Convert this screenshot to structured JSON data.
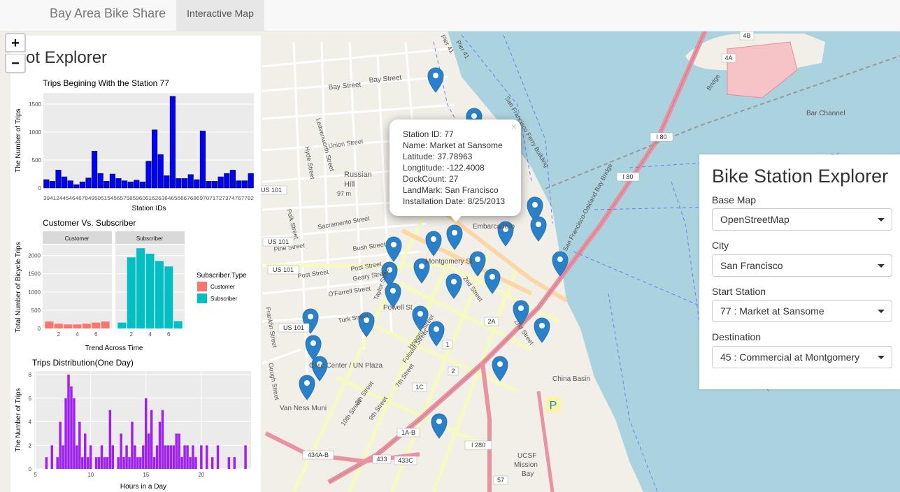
{
  "navbar": {
    "brand": "Bay Area Bike Share",
    "tab_active": "Interactive Map"
  },
  "map": {
    "zoom_in": "+",
    "zoom_out": "−",
    "labels": [
      {
        "text": "Bay Street"
      },
      {
        "text": "Bay Street"
      },
      {
        "text": "Leavenworth Street"
      },
      {
        "text": "Hyde Street"
      },
      {
        "text": "Union Street"
      },
      {
        "text": "Russian"
      },
      {
        "text": "Hill"
      },
      {
        "text": "97 m"
      },
      {
        "text": "Polk Street"
      },
      {
        "text": "Sacramento Street"
      },
      {
        "text": "Pine Street"
      },
      {
        "text": "Bush Street"
      },
      {
        "text": "Post Street"
      },
      {
        "text": "Geary Street"
      },
      {
        "text": "Post Street"
      },
      {
        "text": "O'Farrell Street"
      },
      {
        "text": "Taylor Street"
      },
      {
        "text": "Powell St"
      },
      {
        "text": "Turk Street"
      },
      {
        "text": "Civic Center / UN Plaza"
      },
      {
        "text": "Van Ness Muni"
      },
      {
        "text": "7th Street"
      },
      {
        "text": "8th Street"
      },
      {
        "text": "9th Street"
      },
      {
        "text": "10th Street"
      },
      {
        "text": "Folsom Street"
      },
      {
        "text": "Howard Street"
      },
      {
        "text": "2nd Street"
      },
      {
        "text": "2nd Street"
      },
      {
        "text": "Montgomery St"
      },
      {
        "text": "Embarcadero"
      },
      {
        "text": "China Basin"
      },
      {
        "text": "UCSF"
      },
      {
        "text": "Mission"
      },
      {
        "text": "Bay"
      },
      {
        "text": "Bar Channel"
      },
      {
        "text": "San Francisco-Oakland Bay Bridge"
      },
      {
        "text": "Bridge"
      },
      {
        "text": "Pier 41"
      },
      {
        "text": "San Francisco Ferry Building"
      },
      {
        "text": "Gough Street"
      },
      {
        "text": "Franklin Street"
      },
      {
        "text": "Pier 41"
      }
    ],
    "shields": [
      {
        "text": "US 101"
      },
      {
        "text": "US 101"
      },
      {
        "text": "US 101"
      },
      {
        "text": "US 101"
      },
      {
        "text": "I 80"
      },
      {
        "text": "I 80"
      },
      {
        "text": "I 280"
      },
      {
        "text": "1A-B"
      },
      {
        "text": "1C"
      },
      {
        "text": "2A"
      },
      {
        "text": "433"
      },
      {
        "text": "433C"
      },
      {
        "text": "434A-B"
      },
      {
        "text": "57"
      },
      {
        "text": "4A"
      },
      {
        "text": "4B"
      },
      {
        "text": "1"
      },
      {
        "text": "2"
      }
    ],
    "parking": "P"
  },
  "popup": {
    "close": "×",
    "lines": [
      "Station ID: 77",
      "Name: Market at Sansome",
      "Latitude: 37.78963",
      "Longtitude: -122.4008",
      "DockCount: 27",
      "LandMark: San Francisco",
      "Installation Date: 8/25/2013"
    ]
  },
  "left_panel": {
    "title": "ot Explorer",
    "bar": {
      "title": "Trips Begining With the Station 77",
      "ylabel": "The Number of Trips",
      "xlabel": "Station IDs",
      "xticks_text": "394124454646784950515456575859606162636465666768697071727374767782",
      "yticks": [
        "0",
        "500",
        "1000",
        "1500"
      ],
      "color": "#0000ff"
    },
    "facet": {
      "title": "Customer Vs. Subscriber",
      "ylabel": "Total Number of Bicycle Trips",
      "xlabel": "Trend Across Time",
      "strips": [
        "Customer",
        "Subscriber"
      ],
      "yticks": [
        "0",
        "500",
        "1000",
        "1500",
        "2000"
      ],
      "xticks": [
        "2",
        "4",
        "6"
      ],
      "legend_title": "Subscriber.Type",
      "legend": [
        {
          "label": "Customer",
          "color": "#f8766d"
        },
        {
          "label": "Subscriber",
          "color": "#00bfc4"
        }
      ]
    },
    "hist": {
      "title": "Trips Distribution(One Day)",
      "ylabel": "The Number of Trips",
      "xlabel": "Hours in a Day",
      "yticks": [
        "0",
        "2",
        "4",
        "6",
        "8"
      ],
      "xticks": [
        "5",
        "10",
        "15",
        "20"
      ],
      "color": "#a020f0"
    }
  },
  "right_panel": {
    "title": "Bike Station Explorer",
    "fields": [
      {
        "label": "Base Map",
        "value": "OpenStreetMap"
      },
      {
        "label": "City",
        "value": "San Francisco"
      },
      {
        "label": "Start Station",
        "value": "77 : Market at Sansome"
      },
      {
        "label": "Destination",
        "value": "45 : Commercial at Montgomery"
      }
    ]
  },
  "chart_data": [
    {
      "type": "bar",
      "title": "Trips Begining With the Station 77",
      "xlabel": "Station IDs",
      "ylabel": "The Number of Trips",
      "ylim": [
        0,
        1700
      ],
      "values": [
        150,
        120,
        320,
        200,
        130,
        60,
        110,
        180,
        660,
        260,
        120,
        250,
        170,
        130,
        110,
        140,
        110,
        480,
        1040,
        600,
        220,
        1640,
        170,
        170,
        240,
        150,
        1020,
        120,
        120,
        200,
        260,
        320,
        130,
        130,
        260
      ]
    },
    {
      "type": "bar",
      "title": "Customer Vs. Subscriber",
      "xlabel": "Trend Across Time",
      "ylabel": "Total Number of Bicycle Trips",
      "ylim": [
        0,
        2300
      ],
      "categories": [
        1,
        2,
        3,
        4,
        5,
        6,
        7
      ],
      "series": [
        {
          "name": "Customer",
          "values": [
            190,
            130,
            110,
            110,
            130,
            160,
            190
          ]
        },
        {
          "name": "Subscriber",
          "values": [
            160,
            1950,
            2200,
            2050,
            1850,
            1700,
            200
          ]
        }
      ]
    },
    {
      "type": "bar",
      "title": "Trips Distribution(One Day)",
      "xlabel": "Hours in a Day",
      "ylabel": "The Number of Trips",
      "ylim": [
        0,
        8.3
      ],
      "hours": [
        6.0,
        6.5,
        7.0,
        7.25,
        7.5,
        7.75,
        8.0,
        8.25,
        8.5,
        8.75,
        9.0,
        9.25,
        9.5,
        9.75,
        10.0,
        10.5,
        10.75,
        11.0,
        11.25,
        11.5,
        11.75,
        12.0,
        12.5,
        12.75,
        13.0,
        13.25,
        13.5,
        13.75,
        14.0,
        14.25,
        14.5,
        14.75,
        15.0,
        15.25,
        15.5,
        15.75,
        16.0,
        16.25,
        16.5,
        16.75,
        17.0,
        17.25,
        17.5,
        17.75,
        18.0,
        18.25,
        18.5,
        18.75,
        19.0,
        19.25,
        19.5,
        20.0,
        20.5,
        21.0,
        21.5,
        22.5,
        23.0,
        24.0
      ],
      "counts": [
        1,
        2,
        1,
        4,
        2,
        6,
        8,
        7,
        6,
        2,
        4,
        1,
        3,
        1,
        2,
        1,
        1,
        2,
        1,
        1,
        5,
        2,
        1,
        3,
        1,
        2,
        1,
        4,
        2,
        1,
        1,
        2,
        6,
        3,
        5,
        1,
        2,
        4,
        5,
        2,
        2,
        2,
        2,
        3,
        3,
        1,
        2,
        2,
        1,
        2,
        1,
        2,
        2,
        1,
        2,
        1,
        1,
        2
      ]
    }
  ]
}
